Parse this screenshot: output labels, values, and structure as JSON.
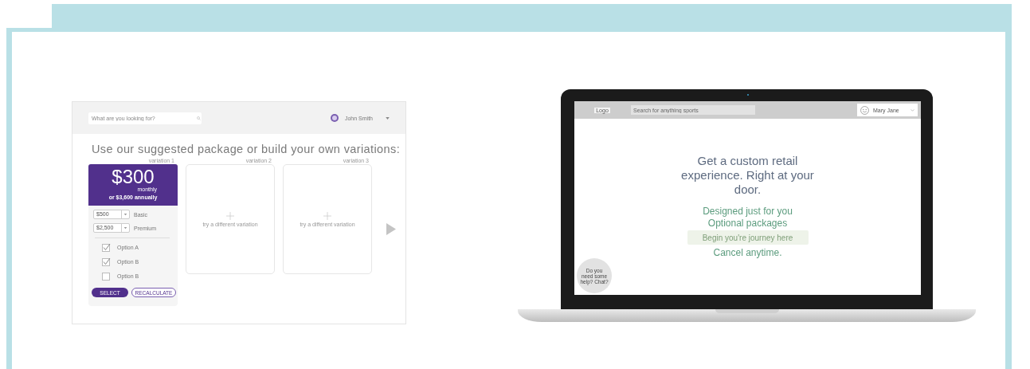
{
  "left_mockup": {
    "search": {
      "placeholder": "What are you looking for?"
    },
    "user": {
      "name": "John Smith"
    },
    "heading": "Use our suggested package or build your own variations:",
    "variations": [
      {
        "kind": "package",
        "label": "variation 1",
        "price": "$300",
        "period": "monthly",
        "annual": "or $3,600 annually",
        "selects": [
          {
            "value": "$500",
            "label": "Basic"
          },
          {
            "value": "$2,500",
            "label": "Premium"
          }
        ],
        "options": [
          {
            "label": "Option A",
            "checked": true
          },
          {
            "label": "Option B",
            "checked": true
          },
          {
            "label": "Option B",
            "checked": false
          }
        ],
        "buttons": [
          {
            "label": "SELECT",
            "kind": "primary"
          },
          {
            "label": "RECALCULATE",
            "kind": "secondary"
          }
        ]
      },
      {
        "kind": "empty",
        "label": "variation 2",
        "hint": "try a different variation"
      },
      {
        "kind": "empty",
        "label": "variation 3",
        "hint": "try a different variation"
      }
    ]
  },
  "right_mockup": {
    "logo": "Logo",
    "search": {
      "placeholder": "Search for anything sports"
    },
    "user": {
      "name": "Mary Jane"
    },
    "headline": "Get a custom retail experience. Right at your door.",
    "features": [
      "Designed just for you",
      "Optional packages",
      "Cancel anytime."
    ],
    "cta": "Begin you're journey here",
    "chat": "Do you need some help? Chat?"
  }
}
